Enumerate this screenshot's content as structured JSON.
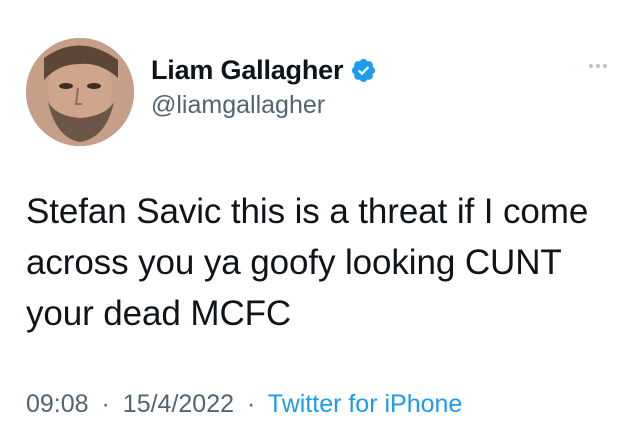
{
  "tweet": {
    "author": {
      "display_name": "Liam Gallagher",
      "handle": "@liamgallagher",
      "verified": true,
      "avatar_icon": "profile-photo"
    },
    "more_icon": "more-options-icon",
    "text": "Stefan Savic this is a threat if I come across you ya goofy looking CUNT your dead MCFC",
    "time": "09:08",
    "separator": "·",
    "date": "15/4/2022",
    "source": "Twitter for iPhone"
  },
  "colors": {
    "text": "#0f1419",
    "secondary": "#536471",
    "accent": "#1d9bf0",
    "verified_badge": "#1d9bf0"
  }
}
